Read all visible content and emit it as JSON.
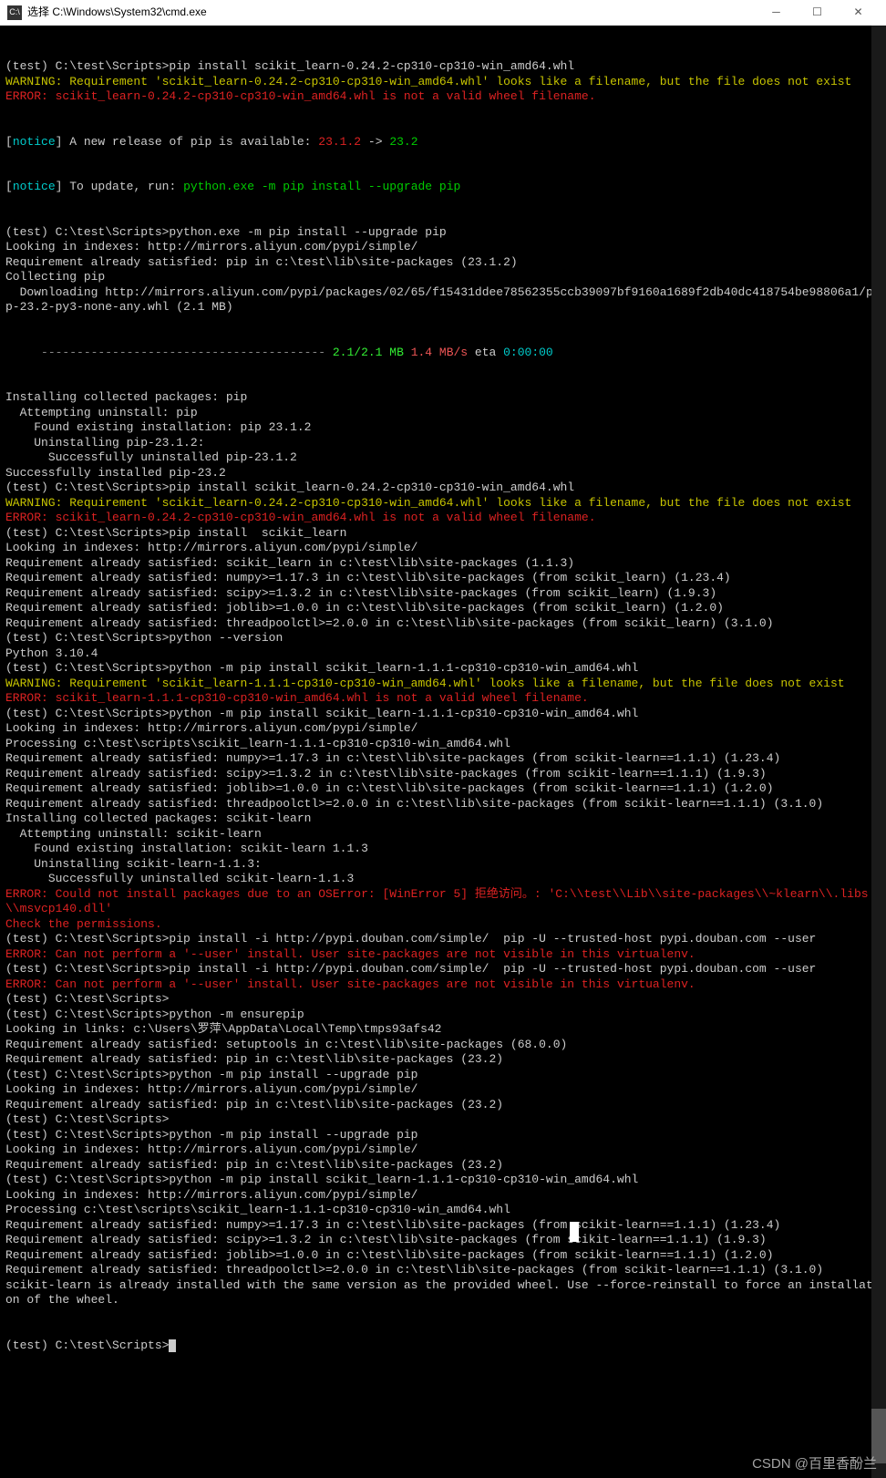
{
  "title": "选择 C:\\Windows\\System32\\cmd.exe",
  "lines": [
    {
      "c": "white",
      "t": ""
    },
    {
      "c": "white",
      "t": "(test) C:\\test\\Scripts>pip install scikit_learn-0.24.2-cp310-cp310-win_amd64.whl"
    },
    {
      "c": "yellow",
      "t": "WARNING: Requirement 'scikit_learn-0.24.2-cp310-cp310-win_amd64.whl' looks like a filename, but the file does not exist"
    },
    {
      "c": "red",
      "t": "ERROR: scikit_learn-0.24.2-cp310-cp310-win_amd64.whl is not a valid wheel filename."
    },
    {
      "c": "white",
      "t": ""
    }
  ],
  "notice1": {
    "prefix": "[",
    "tag": "notice",
    "mid": "] A new release of pip is available: ",
    "v1": "23.1.2",
    "arrow": " -> ",
    "v2": "23.2"
  },
  "notice2": {
    "prefix": "[",
    "tag": "notice",
    "mid": "] To update, run: ",
    "cmd": "python.exe -m pip install --upgrade pip"
  },
  "block2": [
    {
      "c": "white",
      "t": ""
    },
    {
      "c": "white",
      "t": "(test) C:\\test\\Scripts>python.exe -m pip install --upgrade pip"
    },
    {
      "c": "white",
      "t": "Looking in indexes: http://mirrors.aliyun.com/pypi/simple/"
    },
    {
      "c": "white",
      "t": "Requirement already satisfied: pip in c:\\test\\lib\\site-packages (23.1.2)"
    },
    {
      "c": "white",
      "t": "Collecting pip"
    },
    {
      "c": "white",
      "t": "  Downloading http://mirrors.aliyun.com/pypi/packages/02/65/f15431ddee78562355ccb39097bf9160a1689f2db40dc418754be98806a1/pip-23.2-py3-none-any.whl (2.1 MB)"
    }
  ],
  "progress": {
    "bar": "     ---------------------------------------- ",
    "size": "2.1/2.1 MB",
    "speed": " 1.4 MB/s",
    "eta_lbl": " eta ",
    "eta": "0:00:00"
  },
  "block3": [
    {
      "c": "white",
      "t": "Installing collected packages: pip"
    },
    {
      "c": "white",
      "t": "  Attempting uninstall: pip"
    },
    {
      "c": "white",
      "t": "    Found existing installation: pip 23.1.2"
    },
    {
      "c": "white",
      "t": "    Uninstalling pip-23.1.2:"
    },
    {
      "c": "white",
      "t": "      Successfully uninstalled pip-23.1.2"
    },
    {
      "c": "white",
      "t": "Successfully installed pip-23.2"
    },
    {
      "c": "white",
      "t": ""
    },
    {
      "c": "white",
      "t": "(test) C:\\test\\Scripts>pip install scikit_learn-0.24.2-cp310-cp310-win_amd64.whl"
    },
    {
      "c": "yellow",
      "t": "WARNING: Requirement 'scikit_learn-0.24.2-cp310-cp310-win_amd64.whl' looks like a filename, but the file does not exist"
    },
    {
      "c": "red",
      "t": "ERROR: scikit_learn-0.24.2-cp310-cp310-win_amd64.whl is not a valid wheel filename."
    },
    {
      "c": "white",
      "t": ""
    },
    {
      "c": "white",
      "t": "(test) C:\\test\\Scripts>pip install  scikit_learn"
    },
    {
      "c": "white",
      "t": "Looking in indexes: http://mirrors.aliyun.com/pypi/simple/"
    },
    {
      "c": "white",
      "t": "Requirement already satisfied: scikit_learn in c:\\test\\lib\\site-packages (1.1.3)"
    },
    {
      "c": "white",
      "t": "Requirement already satisfied: numpy>=1.17.3 in c:\\test\\lib\\site-packages (from scikit_learn) (1.23.4)"
    },
    {
      "c": "white",
      "t": "Requirement already satisfied: scipy>=1.3.2 in c:\\test\\lib\\site-packages (from scikit_learn) (1.9.3)"
    },
    {
      "c": "white",
      "t": "Requirement already satisfied: joblib>=1.0.0 in c:\\test\\lib\\site-packages (from scikit_learn) (1.2.0)"
    },
    {
      "c": "white",
      "t": "Requirement already satisfied: threadpoolctl>=2.0.0 in c:\\test\\lib\\site-packages (from scikit_learn) (3.1.0)"
    },
    {
      "c": "white",
      "t": ""
    },
    {
      "c": "white",
      "t": "(test) C:\\test\\Scripts>python --version"
    },
    {
      "c": "white",
      "t": "Python 3.10.4"
    },
    {
      "c": "white",
      "t": ""
    },
    {
      "c": "white",
      "t": "(test) C:\\test\\Scripts>python -m pip install scikit_learn-1.1.1-cp310-cp310-win_amd64.whl"
    },
    {
      "c": "yellow",
      "t": "WARNING: Requirement 'scikit_learn-1.1.1-cp310-cp310-win_amd64.whl' looks like a filename, but the file does not exist"
    },
    {
      "c": "red",
      "t": "ERROR: scikit_learn-1.1.1-cp310-cp310-win_amd64.whl is not a valid wheel filename."
    },
    {
      "c": "white",
      "t": ""
    },
    {
      "c": "white",
      "t": "(test) C:\\test\\Scripts>python -m pip install scikit_learn-1.1.1-cp310-cp310-win_amd64.whl"
    },
    {
      "c": "white",
      "t": "Looking in indexes: http://mirrors.aliyun.com/pypi/simple/"
    },
    {
      "c": "white",
      "t": "Processing c:\\test\\scripts\\scikit_learn-1.1.1-cp310-cp310-win_amd64.whl"
    },
    {
      "c": "white",
      "t": "Requirement already satisfied: numpy>=1.17.3 in c:\\test\\lib\\site-packages (from scikit-learn==1.1.1) (1.23.4)"
    },
    {
      "c": "white",
      "t": "Requirement already satisfied: scipy>=1.3.2 in c:\\test\\lib\\site-packages (from scikit-learn==1.1.1) (1.9.3)"
    },
    {
      "c": "white",
      "t": "Requirement already satisfied: joblib>=1.0.0 in c:\\test\\lib\\site-packages (from scikit-learn==1.1.1) (1.2.0)"
    },
    {
      "c": "white",
      "t": "Requirement already satisfied: threadpoolctl>=2.0.0 in c:\\test\\lib\\site-packages (from scikit-learn==1.1.1) (3.1.0)"
    },
    {
      "c": "white",
      "t": "Installing collected packages: scikit-learn"
    },
    {
      "c": "white",
      "t": "  Attempting uninstall: scikit-learn"
    },
    {
      "c": "white",
      "t": "    Found existing installation: scikit-learn 1.1.3"
    },
    {
      "c": "white",
      "t": "    Uninstalling scikit-learn-1.1.3:"
    },
    {
      "c": "white",
      "t": "      Successfully uninstalled scikit-learn-1.1.3"
    },
    {
      "c": "red",
      "t": "ERROR: Could not install packages due to an OSError: [WinError 5] 拒绝访问。: 'C:\\\\test\\\\Lib\\\\site-packages\\\\~klearn\\\\.libs\\\\msvcp140.dll'"
    },
    {
      "c": "red",
      "t": "Check the permissions."
    },
    {
      "c": "white",
      "t": ""
    },
    {
      "c": "white",
      "t": ""
    },
    {
      "c": "white",
      "t": "(test) C:\\test\\Scripts>pip install -i http://pypi.douban.com/simple/  pip -U --trusted-host pypi.douban.com --user"
    },
    {
      "c": "red",
      "t": "ERROR: Can not perform a '--user' install. User site-packages are not visible in this virtualenv."
    },
    {
      "c": "white",
      "t": ""
    },
    {
      "c": "white",
      "t": "(test) C:\\test\\Scripts>pip install -i http://pypi.douban.com/simple/  pip -U --trusted-host pypi.douban.com --user"
    },
    {
      "c": "red",
      "t": "ERROR: Can not perform a '--user' install. User site-packages are not visible in this virtualenv."
    },
    {
      "c": "white",
      "t": ""
    },
    {
      "c": "white",
      "t": "(test) C:\\test\\Scripts>"
    },
    {
      "c": "white",
      "t": "(test) C:\\test\\Scripts>python -m ensurepip"
    },
    {
      "c": "white",
      "t": "Looking in links: c:\\Users\\罗萍\\AppData\\Local\\Temp\\tmps93afs42"
    },
    {
      "c": "white",
      "t": "Requirement already satisfied: setuptools in c:\\test\\lib\\site-packages (68.0.0)"
    },
    {
      "c": "white",
      "t": "Requirement already satisfied: pip in c:\\test\\lib\\site-packages (23.2)"
    },
    {
      "c": "white",
      "t": ""
    },
    {
      "c": "white",
      "t": "(test) C:\\test\\Scripts>python -m pip install --upgrade pip"
    },
    {
      "c": "white",
      "t": "Looking in indexes: http://mirrors.aliyun.com/pypi/simple/"
    },
    {
      "c": "white",
      "t": "Requirement already satisfied: pip in c:\\test\\lib\\site-packages (23.2)"
    },
    {
      "c": "white",
      "t": ""
    },
    {
      "c": "white",
      "t": "(test) C:\\test\\Scripts>"
    },
    {
      "c": "white",
      "t": "(test) C:\\test\\Scripts>python -m pip install --upgrade pip"
    },
    {
      "c": "white",
      "t": "Looking in indexes: http://mirrors.aliyun.com/pypi/simple/"
    },
    {
      "c": "white",
      "t": "Requirement already satisfied: pip in c:\\test\\lib\\site-packages (23.2)"
    },
    {
      "c": "white",
      "t": ""
    },
    {
      "c": "white",
      "t": "(test) C:\\test\\Scripts>python -m pip install scikit_learn-1.1.1-cp310-cp310-win_amd64.whl"
    },
    {
      "c": "white",
      "t": "Looking in indexes: http://mirrors.aliyun.com/pypi/simple/"
    },
    {
      "c": "white",
      "t": "Processing c:\\test\\scripts\\scikit_learn-1.1.1-cp310-cp310-win_amd64.whl"
    },
    {
      "c": "white",
      "t": "Requirement already satisfied: numpy>=1.17.3 in c:\\test\\lib\\site-packages (from scikit-learn==1.1.1) (1.23.4)"
    },
    {
      "c": "white",
      "t": "Requirement already satisfied: scipy>=1.3.2 in c:\\test\\lib\\site-packages (from scikit-learn==1.1.1) (1.9.3)"
    },
    {
      "c": "white",
      "t": "Requirement already satisfied: joblib>=1.0.0 in c:\\test\\lib\\site-packages (from scikit-learn==1.1.1) (1.2.0)"
    },
    {
      "c": "white",
      "t": "Requirement already satisfied: threadpoolctl>=2.0.0 in c:\\test\\lib\\site-packages (from scikit-learn==1.1.1) (3.1.0)"
    },
    {
      "c": "white",
      "t": "scikit-learn is already installed with the same version as the provided wheel. Use --force-reinstall to force an installation of the wheel."
    },
    {
      "c": "white",
      "t": ""
    }
  ],
  "prompt_final": "(test) C:\\test\\Scripts>",
  "watermark": "CSDN @百里香酚兰",
  "icon_text": "C:\\"
}
